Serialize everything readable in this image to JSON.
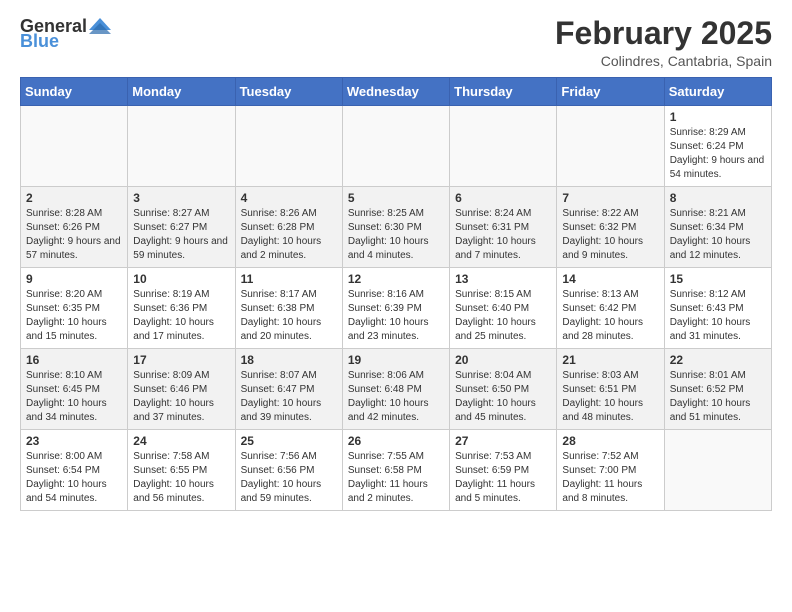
{
  "header": {
    "logo_general": "General",
    "logo_blue": "Blue",
    "month_year": "February 2025",
    "location": "Colindres, Cantabria, Spain"
  },
  "weekdays": [
    "Sunday",
    "Monday",
    "Tuesday",
    "Wednesday",
    "Thursday",
    "Friday",
    "Saturday"
  ],
  "weeks": [
    [
      {
        "day": "",
        "info": ""
      },
      {
        "day": "",
        "info": ""
      },
      {
        "day": "",
        "info": ""
      },
      {
        "day": "",
        "info": ""
      },
      {
        "day": "",
        "info": ""
      },
      {
        "day": "",
        "info": ""
      },
      {
        "day": "1",
        "info": "Sunrise: 8:29 AM\nSunset: 6:24 PM\nDaylight: 9 hours and 54 minutes."
      }
    ],
    [
      {
        "day": "2",
        "info": "Sunrise: 8:28 AM\nSunset: 6:26 PM\nDaylight: 9 hours and 57 minutes."
      },
      {
        "day": "3",
        "info": "Sunrise: 8:27 AM\nSunset: 6:27 PM\nDaylight: 9 hours and 59 minutes."
      },
      {
        "day": "4",
        "info": "Sunrise: 8:26 AM\nSunset: 6:28 PM\nDaylight: 10 hours and 2 minutes."
      },
      {
        "day": "5",
        "info": "Sunrise: 8:25 AM\nSunset: 6:30 PM\nDaylight: 10 hours and 4 minutes."
      },
      {
        "day": "6",
        "info": "Sunrise: 8:24 AM\nSunset: 6:31 PM\nDaylight: 10 hours and 7 minutes."
      },
      {
        "day": "7",
        "info": "Sunrise: 8:22 AM\nSunset: 6:32 PM\nDaylight: 10 hours and 9 minutes."
      },
      {
        "day": "8",
        "info": "Sunrise: 8:21 AM\nSunset: 6:34 PM\nDaylight: 10 hours and 12 minutes."
      }
    ],
    [
      {
        "day": "9",
        "info": "Sunrise: 8:20 AM\nSunset: 6:35 PM\nDaylight: 10 hours and 15 minutes."
      },
      {
        "day": "10",
        "info": "Sunrise: 8:19 AM\nSunset: 6:36 PM\nDaylight: 10 hours and 17 minutes."
      },
      {
        "day": "11",
        "info": "Sunrise: 8:17 AM\nSunset: 6:38 PM\nDaylight: 10 hours and 20 minutes."
      },
      {
        "day": "12",
        "info": "Sunrise: 8:16 AM\nSunset: 6:39 PM\nDaylight: 10 hours and 23 minutes."
      },
      {
        "day": "13",
        "info": "Sunrise: 8:15 AM\nSunset: 6:40 PM\nDaylight: 10 hours and 25 minutes."
      },
      {
        "day": "14",
        "info": "Sunrise: 8:13 AM\nSunset: 6:42 PM\nDaylight: 10 hours and 28 minutes."
      },
      {
        "day": "15",
        "info": "Sunrise: 8:12 AM\nSunset: 6:43 PM\nDaylight: 10 hours and 31 minutes."
      }
    ],
    [
      {
        "day": "16",
        "info": "Sunrise: 8:10 AM\nSunset: 6:45 PM\nDaylight: 10 hours and 34 minutes."
      },
      {
        "day": "17",
        "info": "Sunrise: 8:09 AM\nSunset: 6:46 PM\nDaylight: 10 hours and 37 minutes."
      },
      {
        "day": "18",
        "info": "Sunrise: 8:07 AM\nSunset: 6:47 PM\nDaylight: 10 hours and 39 minutes."
      },
      {
        "day": "19",
        "info": "Sunrise: 8:06 AM\nSunset: 6:48 PM\nDaylight: 10 hours and 42 minutes."
      },
      {
        "day": "20",
        "info": "Sunrise: 8:04 AM\nSunset: 6:50 PM\nDaylight: 10 hours and 45 minutes."
      },
      {
        "day": "21",
        "info": "Sunrise: 8:03 AM\nSunset: 6:51 PM\nDaylight: 10 hours and 48 minutes."
      },
      {
        "day": "22",
        "info": "Sunrise: 8:01 AM\nSunset: 6:52 PM\nDaylight: 10 hours and 51 minutes."
      }
    ],
    [
      {
        "day": "23",
        "info": "Sunrise: 8:00 AM\nSunset: 6:54 PM\nDaylight: 10 hours and 54 minutes."
      },
      {
        "day": "24",
        "info": "Sunrise: 7:58 AM\nSunset: 6:55 PM\nDaylight: 10 hours and 56 minutes."
      },
      {
        "day": "25",
        "info": "Sunrise: 7:56 AM\nSunset: 6:56 PM\nDaylight: 10 hours and 59 minutes."
      },
      {
        "day": "26",
        "info": "Sunrise: 7:55 AM\nSunset: 6:58 PM\nDaylight: 11 hours and 2 minutes."
      },
      {
        "day": "27",
        "info": "Sunrise: 7:53 AM\nSunset: 6:59 PM\nDaylight: 11 hours and 5 minutes."
      },
      {
        "day": "28",
        "info": "Sunrise: 7:52 AM\nSunset: 7:00 PM\nDaylight: 11 hours and 8 minutes."
      },
      {
        "day": "",
        "info": ""
      }
    ]
  ]
}
